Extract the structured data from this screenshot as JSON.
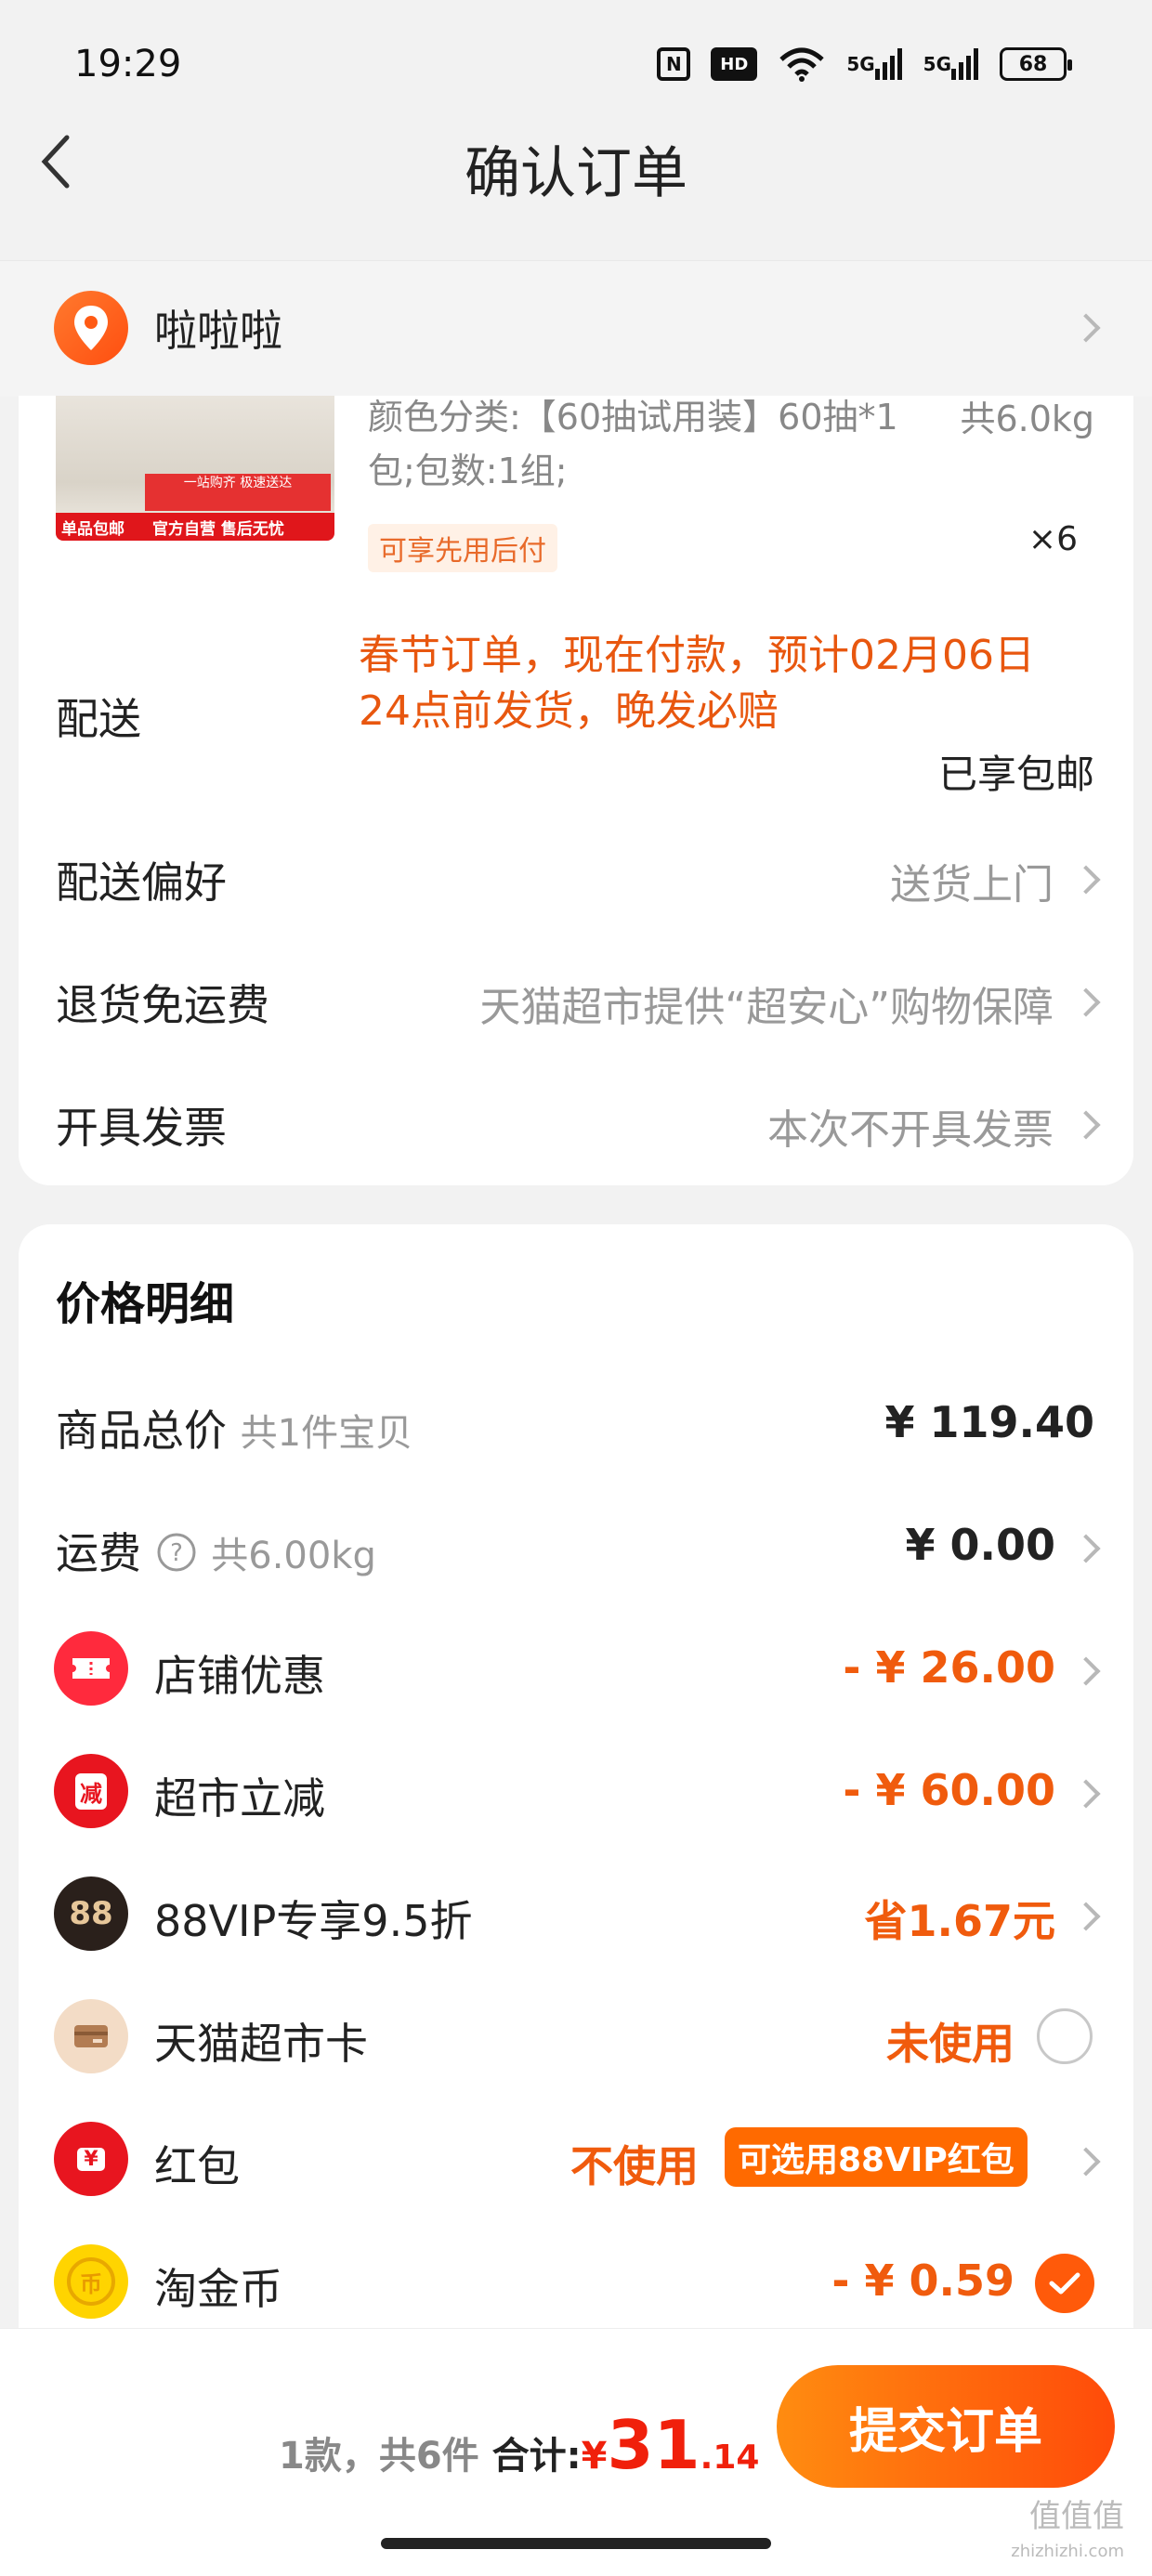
{
  "status_bar": {
    "time": "19:29",
    "hd": "HD",
    "net1": "5G",
    "net2": "5G",
    "battery": "68"
  },
  "header": {
    "title": "确认订单"
  },
  "address": {
    "name": "啦啦啦"
  },
  "product": {
    "spec": "颜色分类:【60抽试用装】60抽*1包;包数:1组;",
    "weight": "共6.0kg",
    "quantity": "×6",
    "bnpl_tag": "可享先用后付",
    "thumb_strip": "单品包邮",
    "thumb_strip2": "官方自营 售后无忧",
    "thumb_mid": "一站购齐 极速送达"
  },
  "rows": {
    "delivery": {
      "label": "配送",
      "note": "春节订单，现在付款，预计02月06日24点前发货，晚发必赔",
      "status": "已享包邮"
    },
    "delivery_pref": {
      "label": "配送偏好",
      "value": "送货上门"
    },
    "return_shipping": {
      "label": "退货免运费",
      "value": "天猫超市提供“超安心”购物保障"
    },
    "invoice": {
      "label": "开具发票",
      "value": "本次不开具发票"
    }
  },
  "price_detail": {
    "title": "价格明细",
    "goods_total": {
      "label": "商品总价",
      "sub": "共1件宝贝",
      "value": "¥ 119.40"
    },
    "shipping": {
      "label": "运费",
      "sub": "共6.00kg",
      "value": "¥ 0.00"
    },
    "shop_discount": {
      "label": "店铺优惠",
      "value": "- ¥ 26.00"
    },
    "market_cut": {
      "label": "超市立减",
      "value": "- ¥ 60.00",
      "icon_text": "减"
    },
    "vip": {
      "label": "88VIP专享9.5折",
      "value": "省1.67元",
      "icon_text": "88"
    },
    "market_card": {
      "label": "天猫超市卡",
      "value": "未使用"
    },
    "red_packet": {
      "label": "红包",
      "value": "不使用",
      "pill": "可选用88VIP红包",
      "icon_text": "¥"
    },
    "coins": {
      "label": "淘金币",
      "value": "- ¥ 0.59",
      "icon_text": "币"
    }
  },
  "bottom": {
    "count_text": "1款，共6件",
    "total_label": "合计:",
    "currency": "¥",
    "total_int": "31",
    "total_dec": ".14",
    "submit_label": "提交订单",
    "watermark": "值值值",
    "watermark_sub": "zhizhizhi.com"
  },
  "colors": {
    "accent": "#ff5a0a",
    "price_red": "#f0200b",
    "delivery_orange": "#e8570f"
  }
}
